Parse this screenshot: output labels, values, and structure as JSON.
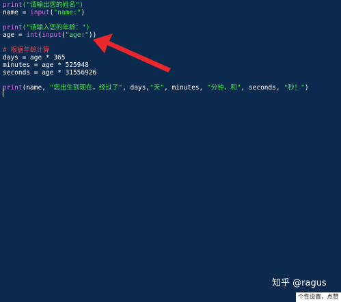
{
  "code": {
    "line1": {
      "kw": "print",
      "rest": "(\"请输出您的姓名\")"
    },
    "line2": {
      "pre": "name = ",
      "kw": "input",
      "open": "(",
      "str": "\"name:\"",
      "close": ")"
    },
    "line4": {
      "kw": "print",
      "rest": "(\"请输入您的年龄：\")"
    },
    "line5": {
      "pre": "age = ",
      "kw1": "int",
      "mid": "(",
      "kw2": "input",
      "open": "(",
      "str": "\"age:\"",
      "close": "))"
    },
    "line7": {
      "comment": "# 根据年龄计算"
    },
    "line8": {
      "text": "days = age * 365"
    },
    "line9": {
      "text": "minutes = age * 525948"
    },
    "line10": {
      "text": "seconds = age * 31556926"
    },
    "line12": {
      "kw": "print",
      "p1": "(name, ",
      "s1": "\"您出生到现在，经过了\"",
      "p2": ", days,",
      "s2": "\"天\"",
      "p3": ", minutes, ",
      "s3": "\"分钟，和\"",
      "p4": ", seconds, ",
      "s4": "\"秒！\"",
      "p5": ")"
    }
  },
  "watermark": "知乎 @ragus",
  "settings_bar": "个性设置，点赞",
  "colors": {
    "background": "#0c2a4e",
    "keyword": "#d870e8",
    "string": "#4ee84e",
    "comment": "#e8484e",
    "arrow": "#e8282a"
  },
  "annotation": {
    "icon": "red-arrow-icon"
  }
}
